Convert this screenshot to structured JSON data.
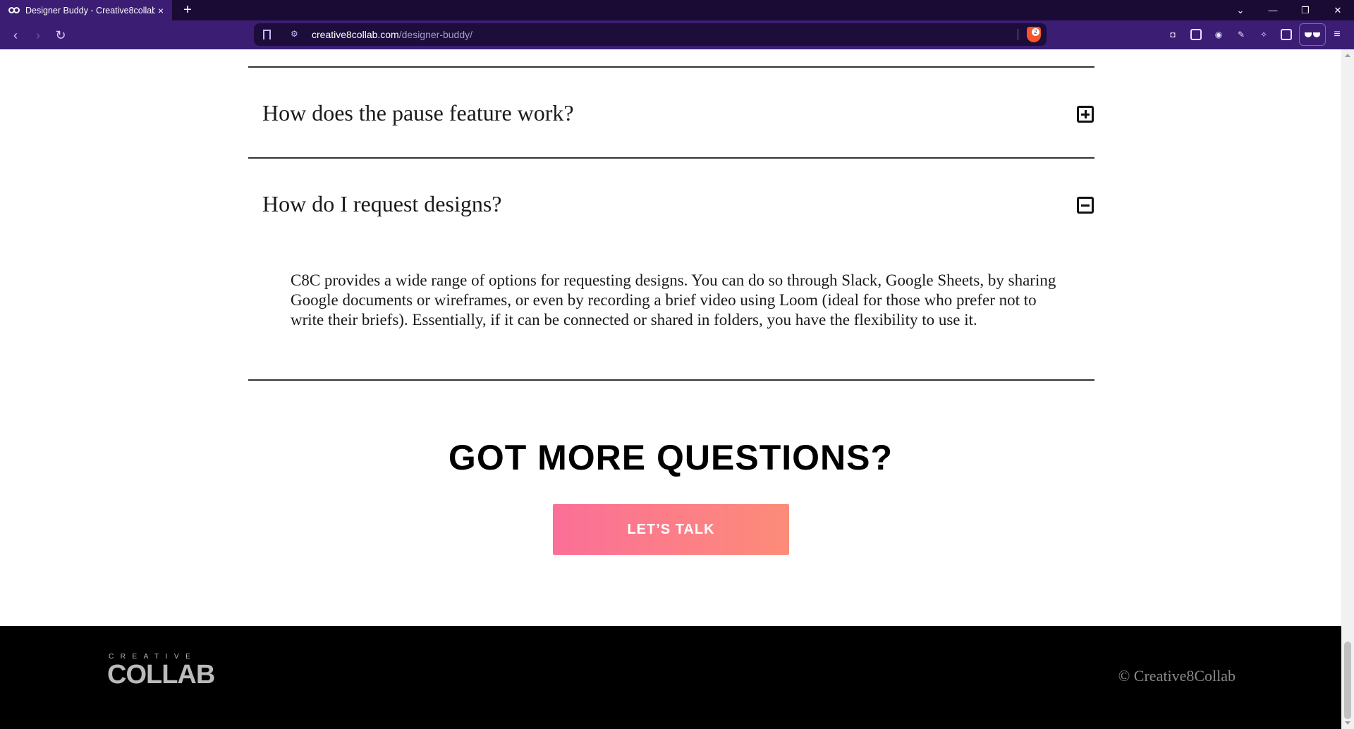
{
  "browser": {
    "tab_title": "Designer Buddy - Creative8collab",
    "tab_close": "×",
    "new_tab": "+",
    "url_domain": "creative8collab.com",
    "url_path": "/designer-buddy/",
    "shields_count": "2"
  },
  "faq": {
    "items": [
      {
        "question": "How does the pause feature work?",
        "expanded": false
      },
      {
        "question": "How do I request designs?",
        "expanded": true,
        "answer": "C8C provides a wide range of options for requesting designs. You can do so through Slack, Google Sheets, by sharing Google documents or wireframes, or even by recording a brief video using Loom (ideal for those who prefer not to write their briefs). Essentially, if it can be connected or shared in folders, you have the flexibility to use it."
      }
    ]
  },
  "cta": {
    "title": "GOT MORE QUESTIONS?",
    "button_label": "LET’S TALK",
    "button_gradient": [
      "#fb6f98",
      "#fc8c78"
    ]
  },
  "footer": {
    "logo_small": "CREATIVE",
    "logo_big": "COLLAB",
    "copyright": "© Creative8Collab"
  },
  "colors": {
    "chrome_dark": "#1a0b35",
    "chrome": "#3b1d73",
    "footer_bg": "#000000"
  }
}
